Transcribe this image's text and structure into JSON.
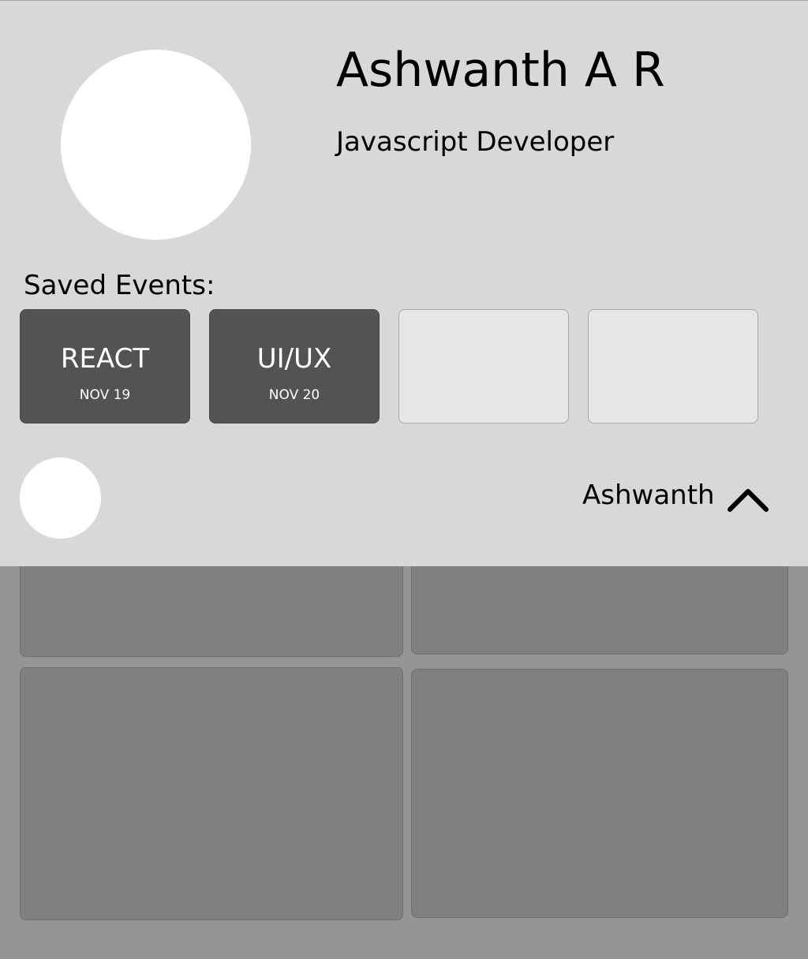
{
  "profile": {
    "name": "Ashwanth A R",
    "role": "Javascript Developer"
  },
  "saved_events": {
    "label": "Saved Events:",
    "items": [
      {
        "title": "REACT",
        "date": "NOV 19"
      },
      {
        "title": "UI/UX",
        "date": "NOV 20"
      },
      {
        "title": "",
        "date": ""
      },
      {
        "title": "",
        "date": ""
      }
    ]
  },
  "user_menu": {
    "username": "Ashwanth",
    "icon": "chevron-up-icon"
  },
  "colors": {
    "panel_background": "#d8d8d8",
    "page_background": "#959595",
    "filled_event_card": "#535353",
    "empty_event_card": "#e6e6e6",
    "background_card": "#808080",
    "avatar": "#ffffff"
  }
}
